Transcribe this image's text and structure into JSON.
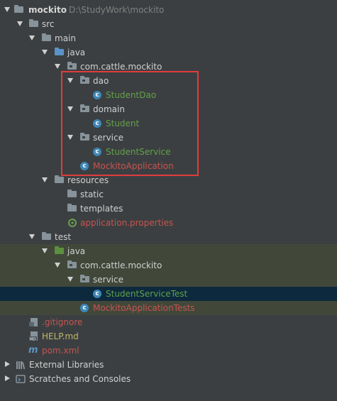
{
  "project": {
    "name": "mockito",
    "path": "D:\\StudyWork\\mockito"
  },
  "tree": {
    "src": "src",
    "main": "main",
    "java": "java",
    "package": "com.cattle.mockito",
    "dao": "dao",
    "student_dao": "StudentDao",
    "domain": "domain",
    "student": "Student",
    "service": "service",
    "student_service": "StudentService",
    "mockito_app": "MockitoApplication",
    "resources": "resources",
    "static": "static",
    "templates": "templates",
    "app_props": "application.properties",
    "test": "test",
    "test_java": "java",
    "test_package": "com.cattle.mockito",
    "test_service": "service",
    "student_service_test": "StudentServiceTest",
    "mockito_app_tests": "MockitoApplicationTests",
    "gitignore": ".gitignore",
    "help": "HELP.md",
    "pom": "pom.xml",
    "external_libraries": "External Libraries",
    "scratches": "Scratches and Consoles"
  },
  "colors": {
    "background": "#3c3f41",
    "selection": "#0d293e",
    "test_highlight": "#41483a",
    "annotation_box": "#e03c3c"
  }
}
